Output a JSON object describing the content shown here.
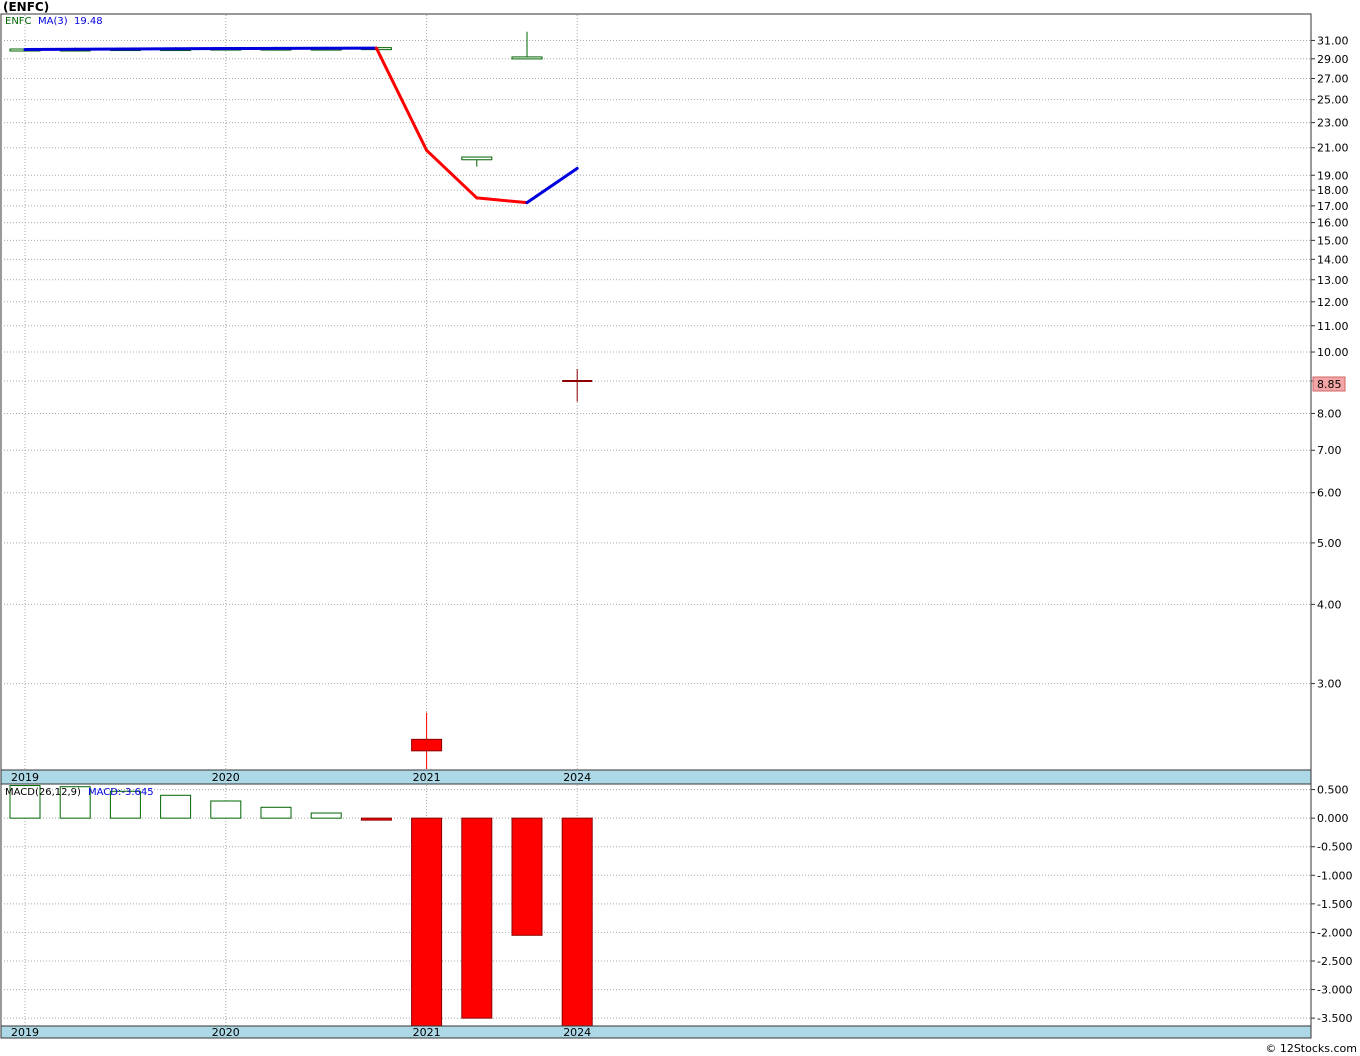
{
  "title": "(ENFC)",
  "watermark": "© 12Stocks.com",
  "price_panel": {
    "legend_symbol": "ENFC",
    "legend_ma_label": "MA(3)",
    "legend_ma_value": "19.48",
    "current_price_label": "8.85",
    "y_ticks": [
      "31.00",
      "29.00",
      "27.00",
      "25.00",
      "23.00",
      "21.00",
      "19.00",
      "18.00",
      "17.00",
      "16.00",
      "15.00",
      "14.00",
      "13.00",
      "12.00",
      "11.00",
      "10.00",
      "9.00",
      "8.00",
      "7.00",
      "6.00",
      "5.00",
      "4.00",
      "3.00"
    ]
  },
  "macd_panel": {
    "legend_label": "MACD(26,12,9)",
    "legend_value": "MACD:-3.645",
    "y_ticks": [
      "0.500",
      "0.000",
      "-0.500",
      "-1.000",
      "-1.500",
      "-2.000",
      "-2.500",
      "-3.000",
      "-3.500"
    ]
  },
  "x_axis_labels": [
    "2019",
    "2020",
    "2021",
    "2024"
  ],
  "colors": {
    "up": "#006400",
    "down": "#ff0000",
    "ma_up": "#0000dd",
    "ma_down": "#ff0000",
    "axis_bar": "#add8e6",
    "grid": "#a9a9a9",
    "price_label_bg": "#f4a6a6"
  },
  "chart_data": [
    {
      "type": "candlestick",
      "title": "(ENFC)",
      "scale": "log",
      "ylim": [
        2.2,
        34
      ],
      "candles": [
        {
          "slot": 0,
          "open": 30.0,
          "high": 30.1,
          "low": 29.9,
          "close": 30.05
        },
        {
          "slot": 1,
          "open": 30.05,
          "high": 30.1,
          "low": 30.0,
          "close": 30.05
        },
        {
          "slot": 2,
          "open": 30.1,
          "high": 30.15,
          "low": 30.05,
          "close": 30.1
        },
        {
          "slot": 3,
          "open": 30.1,
          "high": 30.15,
          "low": 30.05,
          "close": 30.1
        },
        {
          "slot": 4,
          "open": 30.1,
          "high": 30.2,
          "low": 30.05,
          "close": 30.15
        },
        {
          "slot": 5,
          "open": 30.15,
          "high": 30.2,
          "low": 30.1,
          "close": 30.15
        },
        {
          "slot": 6,
          "open": 30.15,
          "high": 30.2,
          "low": 30.1,
          "close": 30.15
        },
        {
          "slot": 7,
          "open": 30.2,
          "high": 30.25,
          "low": 30.1,
          "close": 30.2
        },
        {
          "slot": 8,
          "open": 2.45,
          "high": 2.7,
          "low": 2.2,
          "close": 2.35
        },
        {
          "slot": 9,
          "open": 20.1,
          "high": 20.3,
          "low": 19.6,
          "close": 20.3
        },
        {
          "slot": 10,
          "open": 29.0,
          "high": 32.0,
          "low": 29.0,
          "close": 29.2
        },
        {
          "slot": 11,
          "open": 9.0,
          "high": 9.4,
          "low": 8.35,
          "close": 8.85
        }
      ],
      "ma": {
        "name": "MA(3)",
        "points": [
          {
            "slot": 0,
            "value": 30.0
          },
          {
            "slot": 1,
            "value": 30.02
          },
          {
            "slot": 2,
            "value": 30.05
          },
          {
            "slot": 3,
            "value": 30.08
          },
          {
            "slot": 4,
            "value": 30.1
          },
          {
            "slot": 5,
            "value": 30.12
          },
          {
            "slot": 6,
            "value": 30.13
          },
          {
            "slot": 7,
            "value": 30.15
          },
          {
            "slot": 8,
            "value": 20.8
          },
          {
            "slot": 9,
            "value": 17.5
          },
          {
            "slot": 10,
            "value": 17.2
          },
          {
            "slot": 11,
            "value": 19.48
          }
        ]
      },
      "x_labels": [
        {
          "slot": 0,
          "label": "2019"
        },
        {
          "slot": 4,
          "label": "2020"
        },
        {
          "slot": 8,
          "label": "2021"
        },
        {
          "slot": 11,
          "label": "2024"
        }
      ]
    },
    {
      "type": "bar",
      "title": "MACD(26,12,9)",
      "ylim": [
        -3.62,
        0.58
      ],
      "bars": [
        {
          "slot": 0,
          "value": 0.57
        },
        {
          "slot": 1,
          "value": 0.55
        },
        {
          "slot": 2,
          "value": 0.47
        },
        {
          "slot": 3,
          "value": 0.4
        },
        {
          "slot": 4,
          "value": 0.3
        },
        {
          "slot": 5,
          "value": 0.19
        },
        {
          "slot": 6,
          "value": 0.09
        },
        {
          "slot": 7,
          "value": -0.02
        },
        {
          "slot": 8,
          "value": -3.7
        },
        {
          "slot": 9,
          "value": -3.5
        },
        {
          "slot": 10,
          "value": -2.05
        },
        {
          "slot": 11,
          "value": -3.645
        }
      ]
    }
  ]
}
